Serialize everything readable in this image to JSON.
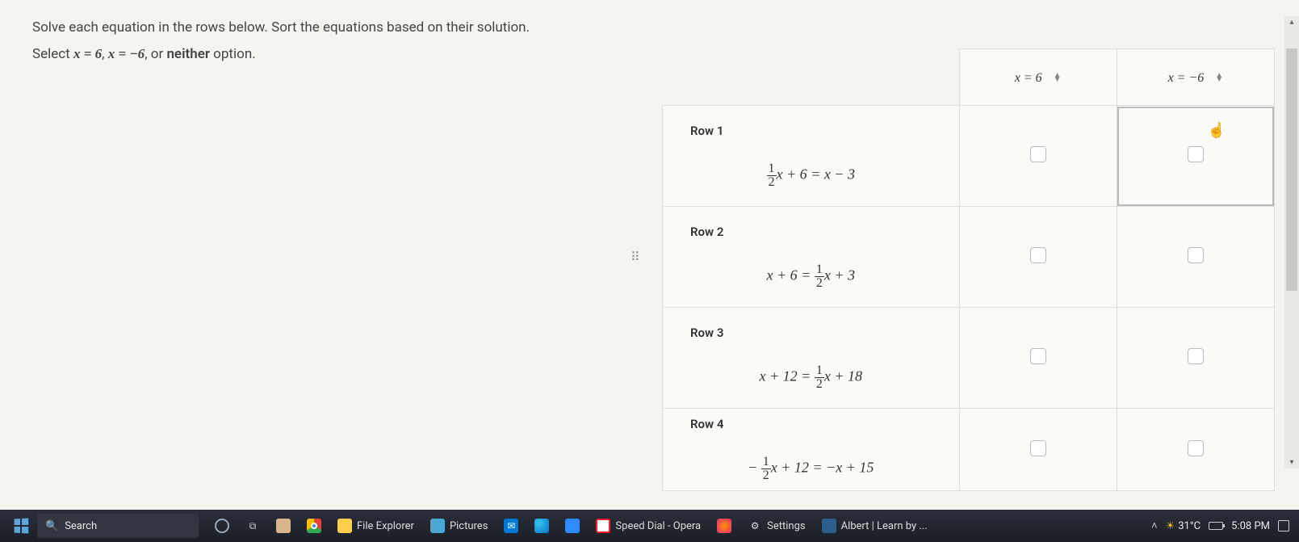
{
  "instructions": {
    "line1": "Solve each equation in the rows below. Sort the equations based on their solution.",
    "line2_pre": "Select ",
    "opt1": "x = 6",
    "sep1": ", ",
    "opt2": "x = −6",
    "sep2": ", or ",
    "opt3": "neither",
    "post": " option."
  },
  "headers": {
    "col1": "x = 6",
    "col2": "x = −6"
  },
  "rows": [
    {
      "label": "Row 1",
      "eq_a_frac_num": "1",
      "eq_a_frac_den": "2",
      "eq_a_rest": "x + 6 = x − 3"
    },
    {
      "label": "Row 2",
      "eq_b_pre": "x + 6 = ",
      "eq_b_frac_num": "1",
      "eq_b_frac_den": "2",
      "eq_b_post": "x + 3"
    },
    {
      "label": "Row 3",
      "eq_c_pre": "x + 12 = ",
      "eq_c_frac_num": "1",
      "eq_c_frac_den": "2",
      "eq_c_post": "x + 18"
    },
    {
      "label": "Row 4",
      "eq_d_pre": "− ",
      "eq_d_frac_num": "1",
      "eq_d_frac_den": "2",
      "eq_d_post": "x + 12 = −x + 15"
    }
  ],
  "taskbar": {
    "search_placeholder": "Search",
    "items": {
      "taskview": "",
      "chrome": "",
      "file_explorer": "File Explorer",
      "pictures": "Pictures",
      "mail": "",
      "edge": "",
      "zoom": "",
      "opera": "Speed Dial - Opera",
      "firefox": "",
      "settings": "Settings",
      "albert": "Albert | Learn by ..."
    },
    "tray": {
      "weather": "31°C",
      "time": "5:08 PM"
    }
  }
}
